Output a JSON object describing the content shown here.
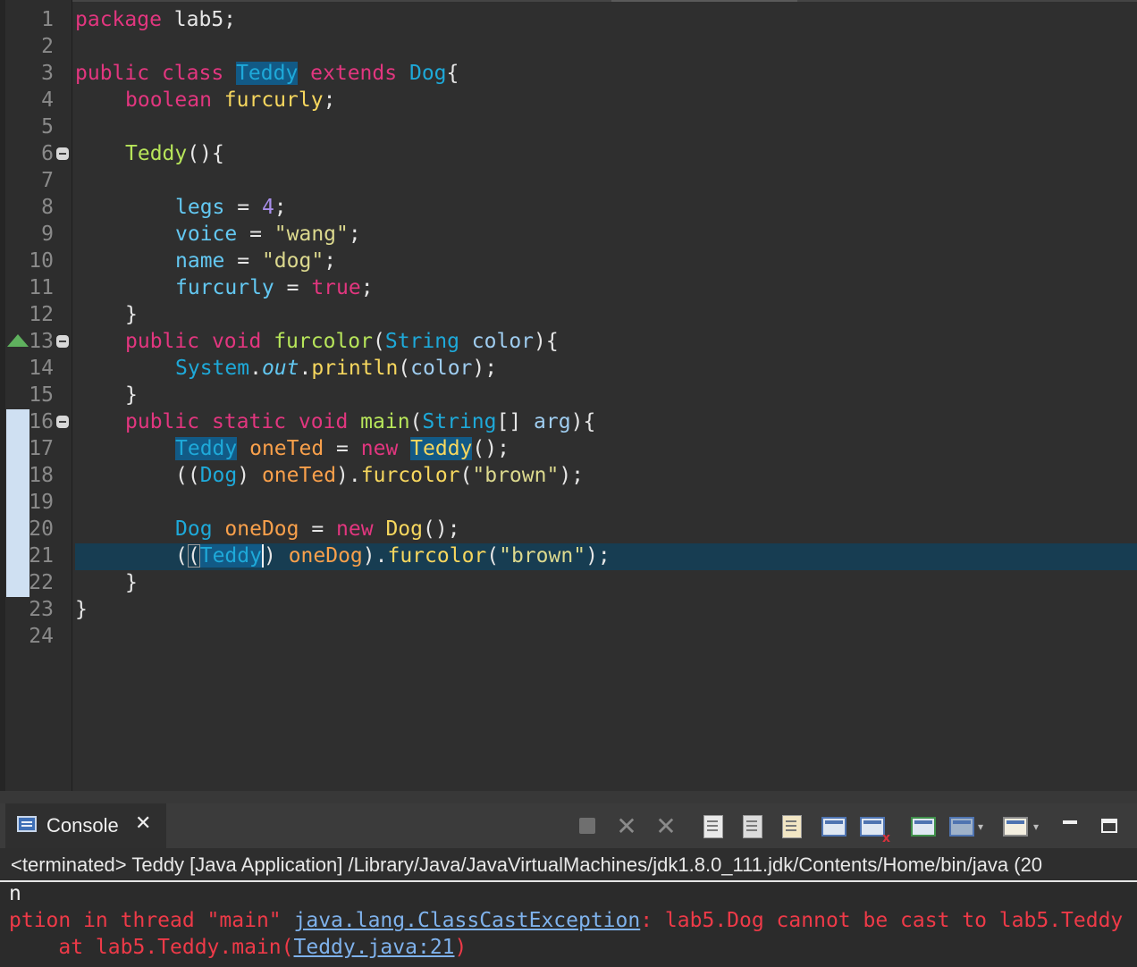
{
  "editor": {
    "line_numbers": [
      "1",
      "2",
      "3",
      "4",
      "5",
      "6",
      "7",
      "8",
      "9",
      "10",
      "11",
      "12",
      "13",
      "14",
      "15",
      "16",
      "17",
      "18",
      "19",
      "20",
      "21",
      "22",
      "23",
      "24"
    ],
    "code": {
      "l1_a": "package",
      "l1_b": " lab5;",
      "l3_a": "public",
      "l3_b": " ",
      "l3_c": "class",
      "l3_d": " ",
      "l3_e": "Teddy",
      "l3_f": " ",
      "l3_g": "extends",
      "l3_h": " ",
      "l3_i": "Dog",
      "l3_j": "{",
      "l4_a": "boolean",
      "l4_b": " ",
      "l4_c": "furcurly",
      "l4_d": ";",
      "l6_a": "Teddy",
      "l6_b": "(){",
      "l8_a": "legs",
      "l8_b": " = ",
      "l8_c": "4",
      "l8_d": ";",
      "l9_a": "voice",
      "l9_b": " = ",
      "l9_c": "\"wang\"",
      "l9_d": ";",
      "l10_a": "name",
      "l10_b": " = ",
      "l10_c": "\"dog\"",
      "l10_d": ";",
      "l11_a": "furcurly",
      "l11_b": " = ",
      "l11_c": "true",
      "l11_d": ";",
      "l12_a": "}",
      "l13_a": "public",
      "l13_b": " ",
      "l13_c": "void",
      "l13_d": " ",
      "l13_e": "furcolor",
      "l13_f": "(",
      "l13_g": "String",
      "l13_h": " ",
      "l13_i": "color",
      "l13_j": "){",
      "l14_a": "System",
      "l14_b": ".",
      "l14_c": "out",
      "l14_d": ".",
      "l14_e": "println",
      "l14_f": "(",
      "l14_g": "color",
      "l14_h": ");",
      "l15_a": "}",
      "l16_a": "public",
      "l16_b": " ",
      "l16_c": "static",
      "l16_d": " ",
      "l16_e": "void",
      "l16_f": " ",
      "l16_g": "main",
      "l16_h": "(",
      "l16_i": "String",
      "l16_j": "[] ",
      "l16_k": "arg",
      "l16_l": "){",
      "l17_a": "Teddy",
      "l17_b": " ",
      "l17_c": "oneTed",
      "l17_d": " = ",
      "l17_e": "new",
      "l17_f": " ",
      "l17_g": "Teddy",
      "l17_h": "();",
      "l18_a": "((",
      "l18_b": "Dog",
      "l18_c": ") ",
      "l18_d": "oneTed",
      "l18_e": ").",
      "l18_f": "furcolor",
      "l18_g": "(",
      "l18_h": "\"brown\"",
      "l18_i": ");",
      "l20_a": "Dog",
      "l20_b": " ",
      "l20_c": "oneDog",
      "l20_d": " = ",
      "l20_e": "new",
      "l20_f": " ",
      "l20_g": "Dog",
      "l20_h": "();",
      "l21_a": "(",
      "l21_b": "(",
      "l21_c": "Teddy",
      "l21_d": ")",
      "l21_e": " ",
      "l21_f": "oneDog",
      "l21_g": ").",
      "l21_h": "furcolor",
      "l21_i": "(",
      "l21_j": "\"brown\"",
      "l21_k": ");",
      "l22_a": "}",
      "l23_a": "}"
    }
  },
  "console": {
    "tab_label": "Console",
    "tab_close": "✕",
    "header": "<terminated> Teddy [Java Application] /Library/Java/JavaVirtualMachines/jdk1.8.0_111.jdk/Contents/Home/bin/java (20",
    "out_line1": "n",
    "err_prefix": "ption in thread \"main\" ",
    "err_link": "java.lang.ClassCastException",
    "err_msg": ": lab5.Dog cannot be cast to lab5.Teddy",
    "trace_prefix": "    at lab5.Teddy.main(",
    "trace_link": "Teddy.java:21",
    "trace_suffix": ")"
  },
  "toolbar": {
    "remove_glyph": "✕",
    "remove_all_glyph": "✕",
    "dropdown_glyph": "▾",
    "error_glyph": "x",
    "icons": [
      "terminate-icon",
      "remove-launch-icon",
      "remove-all-terminated-icon",
      "clear-console-icon",
      "scroll-lock-icon",
      "word-wrap-icon",
      "show-on-stdout-icon",
      "show-on-stderr-icon",
      "pin-console-icon",
      "display-console-icon",
      "open-console-icon",
      "minimize-icon",
      "maximize-icon"
    ]
  }
}
